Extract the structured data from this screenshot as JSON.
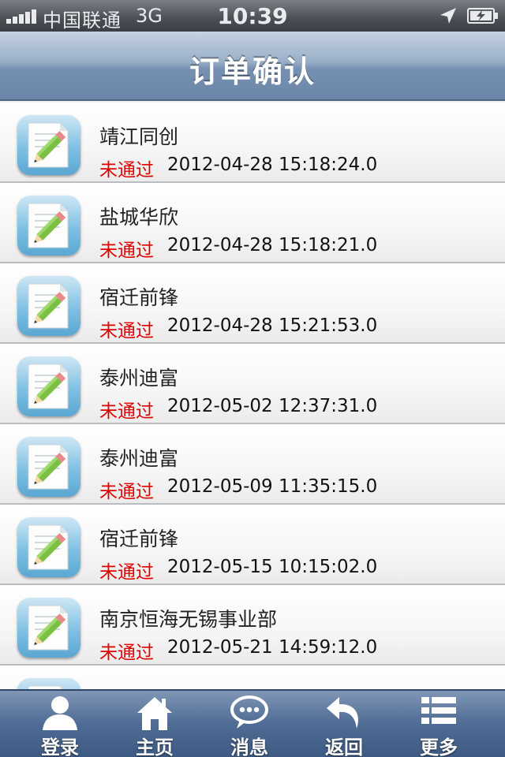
{
  "status_bar": {
    "carrier": "中国联通",
    "network": "3G",
    "time": "10:39",
    "location_icon": "location-arrow-icon",
    "battery_icon": "battery-charging-icon"
  },
  "nav": {
    "title": "订单确认"
  },
  "orders": [
    {
      "name": "靖江同创",
      "status": "未通过",
      "time": "2012-04-28 15:18:24.0"
    },
    {
      "name": "盐城华欣",
      "status": "未通过",
      "time": "2012-04-28 15:18:21.0"
    },
    {
      "name": "宿迁前锋",
      "status": "未通过",
      "time": "2012-04-28 15:21:53.0"
    },
    {
      "name": "泰州迪富",
      "status": "未通过",
      "time": "2012-05-02 12:37:31.0"
    },
    {
      "name": "泰州迪富",
      "status": "未通过",
      "time": "2012-05-09 11:35:15.0"
    },
    {
      "name": "宿迁前锋",
      "status": "未通过",
      "time": "2012-05-15 10:15:02.0"
    },
    {
      "name": "南京恒海无锡事业部",
      "status": "未通过",
      "time": "2012-05-21 14:59:12.0"
    }
  ],
  "tabs": [
    {
      "label": "登录",
      "icon": "user-icon"
    },
    {
      "label": "主页",
      "icon": "home-icon"
    },
    {
      "label": "消息",
      "icon": "chat-bubble-icon"
    },
    {
      "label": "返回",
      "icon": "back-arrow-icon"
    },
    {
      "label": "更多",
      "icon": "list-icon"
    }
  ],
  "colors": {
    "status_red": "#e00000",
    "nav_blue": "#7690b1",
    "tab_blue": "#4f6c94"
  }
}
